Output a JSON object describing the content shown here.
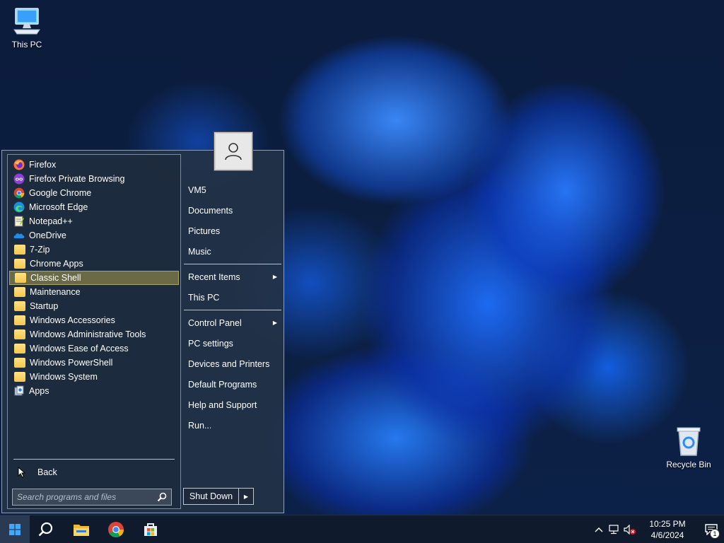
{
  "desktop": {
    "icons": [
      {
        "label": "This PC"
      },
      {
        "label": "Recycle Bin"
      }
    ]
  },
  "start_menu": {
    "programs": [
      {
        "label": "Firefox",
        "icon": "firefox-icon"
      },
      {
        "label": "Firefox Private Browsing",
        "icon": "firefox-private-icon"
      },
      {
        "label": "Google Chrome",
        "icon": "chrome-icon"
      },
      {
        "label": "Microsoft Edge",
        "icon": "edge-icon"
      },
      {
        "label": "Notepad++",
        "icon": "notepadpp-icon"
      },
      {
        "label": "OneDrive",
        "icon": "onedrive-icon"
      },
      {
        "label": "7-Zip",
        "icon": "folder-icon"
      },
      {
        "label": "Chrome Apps",
        "icon": "folder-icon"
      },
      {
        "label": "Classic Shell",
        "icon": "folder-icon",
        "selected": true
      },
      {
        "label": "Maintenance",
        "icon": "folder-icon"
      },
      {
        "label": "Startup",
        "icon": "folder-icon"
      },
      {
        "label": "Windows Accessories",
        "icon": "folder-icon"
      },
      {
        "label": "Windows Administrative Tools",
        "icon": "folder-icon"
      },
      {
        "label": "Windows Ease of Access",
        "icon": "folder-icon"
      },
      {
        "label": "Windows PowerShell",
        "icon": "folder-icon"
      },
      {
        "label": "Windows System",
        "icon": "folder-icon"
      },
      {
        "label": "Apps",
        "icon": "apps-icon"
      }
    ],
    "back_label": "Back",
    "search_placeholder": "Search programs and files",
    "right_items": [
      {
        "label": "VM5"
      },
      {
        "label": "Documents"
      },
      {
        "label": "Pictures"
      },
      {
        "label": "Music"
      },
      {
        "label": "Recent Items",
        "submenu": true
      },
      {
        "label": "This PC"
      },
      {
        "label": "Control Panel",
        "submenu": true
      },
      {
        "label": "PC settings"
      },
      {
        "label": "Devices and Printers"
      },
      {
        "label": "Default Programs"
      },
      {
        "label": "Help and Support"
      },
      {
        "label": "Run..."
      }
    ],
    "shutdown_label": "Shut Down"
  },
  "taskbar": {
    "time": "10:25 PM",
    "date": "4/6/2024",
    "notification_count": "1"
  },
  "colors": {
    "selected_bg": "#6b6a46",
    "menu_bg": "#23324a",
    "taskbar_bg": "#0f1a2c"
  }
}
